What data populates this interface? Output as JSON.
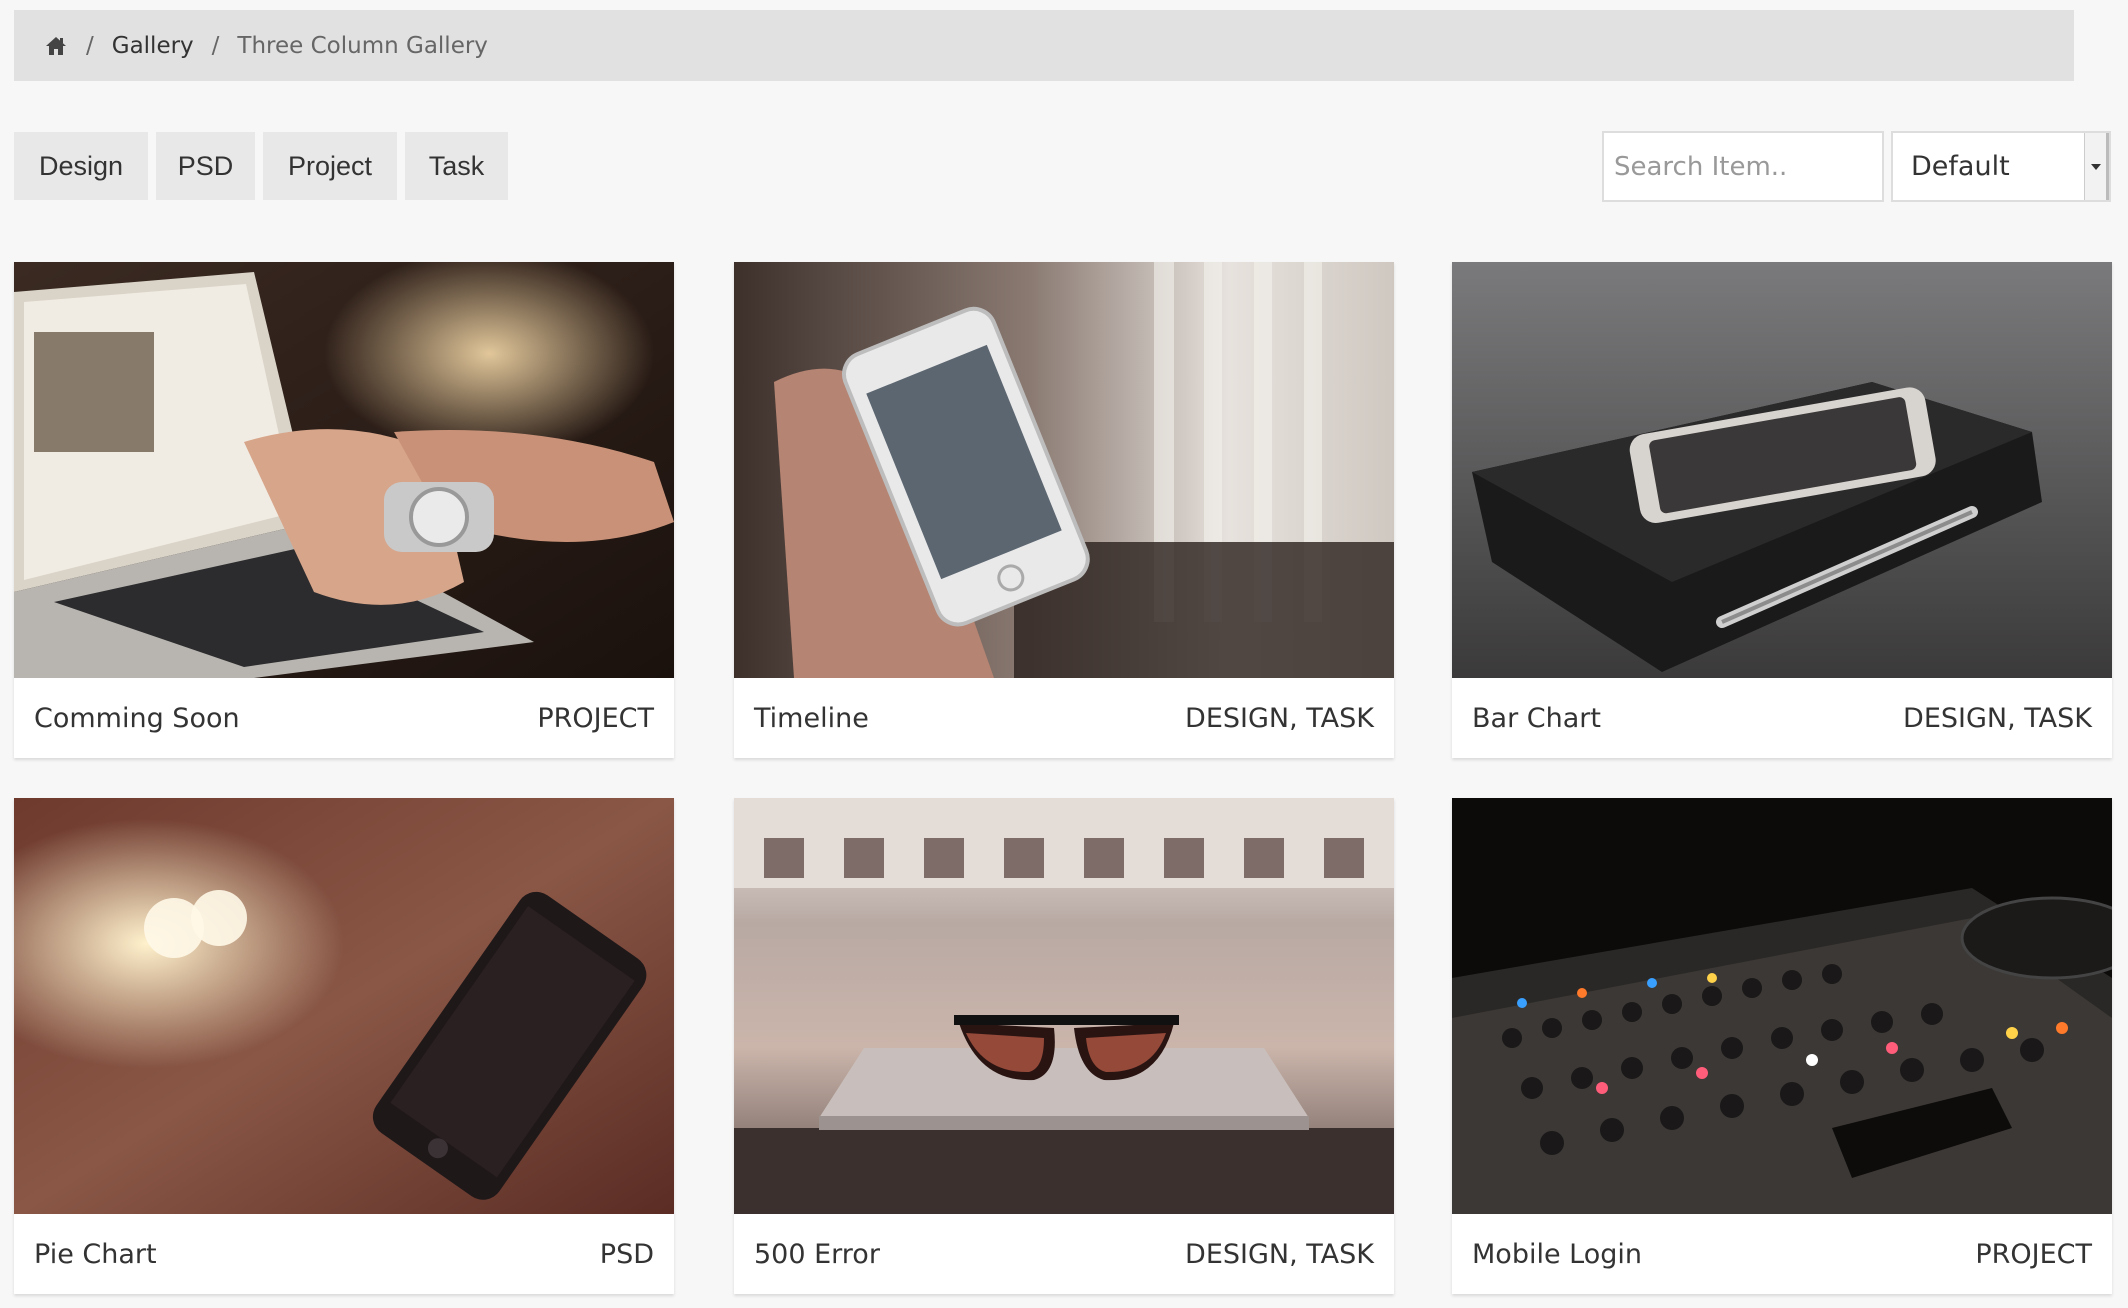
{
  "breadcrumb": {
    "home_icon": "home-icon",
    "separator": "/",
    "items": [
      "Gallery",
      "Three Column Gallery"
    ]
  },
  "filters": {
    "buttons": [
      "Design",
      "PSD",
      "Project",
      "Task"
    ]
  },
  "search": {
    "placeholder": "Search Item..",
    "value": ""
  },
  "sort": {
    "selected": "Default"
  },
  "gallery": {
    "items": [
      {
        "title": "Comming Soon",
        "tags": "PROJECT",
        "image": "laptop-typing-photo"
      },
      {
        "title": "Timeline",
        "tags": "DESIGN, TASK",
        "image": "hand-holding-phone-photo"
      },
      {
        "title": "Bar Chart",
        "tags": "DESIGN, TASK",
        "image": "phone-on-notebook-photo"
      },
      {
        "title": "Pie Chart",
        "tags": "PSD",
        "image": "dark-phone-photo"
      },
      {
        "title": "500 Error",
        "tags": "DESIGN, TASK",
        "image": "sunglasses-on-laptop-photo"
      },
      {
        "title": "Mobile Login",
        "tags": "PROJECT",
        "image": "dj-mixer-photo"
      }
    ]
  },
  "colors": {
    "page_bg": "#f7f7f7",
    "breadcrumb_bg": "#e1e1e1",
    "filter_bg": "#e8e8e8",
    "text": "#333333"
  }
}
